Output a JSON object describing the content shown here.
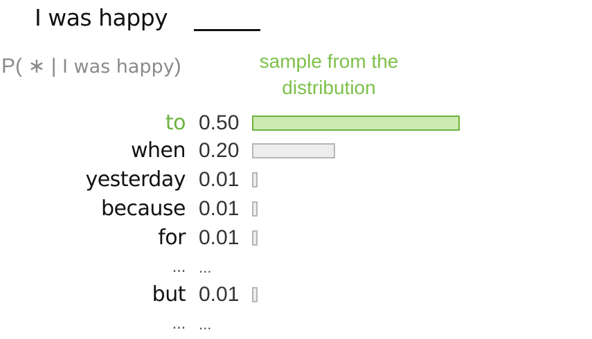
{
  "prompt": {
    "text": "I was happy"
  },
  "probability_label": {
    "prefix": "P( ∗ | ",
    "context": "I was happy",
    "suffix": ")"
  },
  "annotation": {
    "line1": "sample from the",
    "line2": "distribution"
  },
  "distribution": [
    {
      "word": "to",
      "prob_text": "0.50",
      "p": 0.5,
      "selected": true
    },
    {
      "word": "when",
      "prob_text": "0.20",
      "p": 0.2,
      "selected": false
    },
    {
      "word": "yesterday",
      "prob_text": "0.01",
      "p": 0.01,
      "selected": false
    },
    {
      "word": "because",
      "prob_text": "0.01",
      "p": 0.01,
      "selected": false
    },
    {
      "word": "for",
      "prob_text": "0.01",
      "p": 0.01,
      "selected": false
    },
    {
      "ellipsis": true,
      "word": "...",
      "prob_text": "..."
    },
    {
      "word": "but",
      "prob_text": "0.01",
      "p": 0.01,
      "selected": false
    },
    {
      "ellipsis": true,
      "word": "...",
      "prob_text": "..."
    }
  ],
  "colors": {
    "selected": "#6db33f",
    "selected_fill": "#cdeab3",
    "bar_border": "#b5b5b5",
    "bar_fill": "#ededed"
  }
}
